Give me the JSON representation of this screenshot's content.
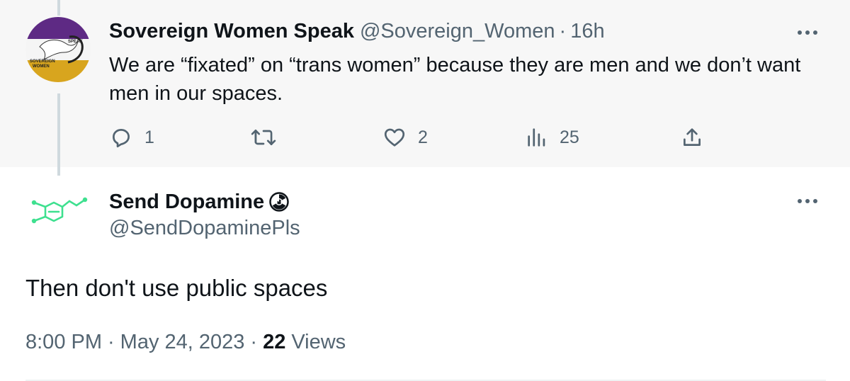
{
  "parent_tweet": {
    "author_name": "Sovereign Women Speak",
    "handle": "@Sovereign_Women",
    "separator": "·",
    "time": "16h",
    "text": "We are “fixated” on “trans women” because they are men and we don’t want men in our spaces.",
    "avatar": {
      "label_top": "SPEAK",
      "label_bottom": "SOVEREIGN WOMEN",
      "colors": {
        "top": "#5e2a84",
        "middle": "#f5f5f5",
        "bottom": "#d8a51e"
      }
    },
    "actions": {
      "reply": {
        "icon": "reply-icon",
        "count": "1"
      },
      "retweet": {
        "icon": "retweet-icon",
        "count": ""
      },
      "like": {
        "icon": "heart-icon",
        "count": "2"
      },
      "views": {
        "icon": "analytics-icon",
        "count": "25"
      },
      "share": {
        "icon": "share-icon",
        "count": ""
      }
    }
  },
  "main_tweet": {
    "author_name": "Send Dopamine",
    "name_badge_icon": "radiation-icon",
    "handle": "@SendDopaminePls",
    "text": "Then don't use public spaces",
    "avatar": {
      "icon": "dopamine-molecule-icon",
      "color": "#3ee08f"
    },
    "meta": {
      "time": "8:00 PM",
      "date": "May 24, 2023",
      "separator": "·",
      "views_count": "22",
      "views_label": "Views"
    }
  },
  "colors": {
    "parent_background": "#f7f7f7",
    "primary_text": "#0f1419",
    "secondary_text": "#536471",
    "thread_line": "#cfd9de"
  }
}
